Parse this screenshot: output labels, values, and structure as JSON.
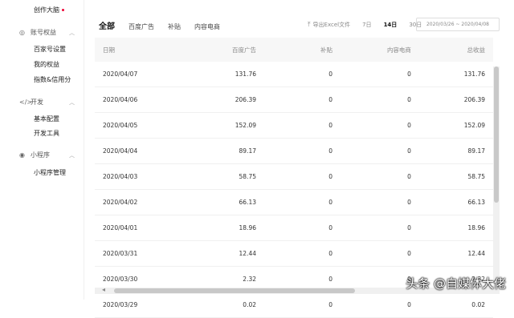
{
  "sidebar": {
    "top_item": "创作大脑",
    "sections": [
      {
        "icon": "shield-icon",
        "title": "账号权益",
        "items": [
          "百家号设置",
          "我的权益",
          "指数&信用分"
        ]
      },
      {
        "icon": "code-icon",
        "title": "开发",
        "items": [
          "基本配置",
          "开发工具"
        ]
      },
      {
        "icon": "miniprogram-icon",
        "title": "小程序",
        "items": [
          "小程序管理"
        ]
      }
    ]
  },
  "tabs": [
    "全部",
    "百度广告",
    "补贴",
    "内容电商"
  ],
  "toolbar": {
    "export_label": "导出Excel文件",
    "ranges": [
      "7日",
      "14日",
      "30日"
    ],
    "selected_range": "14日",
    "date_range": "2020/03/26 ~ 2020/04/08"
  },
  "table": {
    "columns": [
      "日期",
      "百度广告",
      "补贴",
      "内容电商",
      "总收益"
    ],
    "rows": [
      [
        "2020/04/07",
        "131.76",
        "0",
        "0",
        "131.76"
      ],
      [
        "2020/04/06",
        "206.39",
        "0",
        "0",
        "206.39"
      ],
      [
        "2020/04/05",
        "152.09",
        "0",
        "0",
        "152.09"
      ],
      [
        "2020/04/04",
        "89.17",
        "0",
        "0",
        "89.17"
      ],
      [
        "2020/04/03",
        "58.75",
        "0",
        "0",
        "58.75"
      ],
      [
        "2020/04/02",
        "66.13",
        "0",
        "0",
        "66.13"
      ],
      [
        "2020/04/01",
        "18.96",
        "0",
        "0",
        "18.96"
      ],
      [
        "2020/03/31",
        "12.44",
        "0",
        "0",
        "12.44"
      ],
      [
        "2020/03/30",
        "2.32",
        "0",
        "0",
        "2.32"
      ],
      [
        "2020/03/29",
        "0.02",
        "0",
        "0",
        "0.02"
      ]
    ]
  },
  "watermark": "头条 @自媒体大佬"
}
